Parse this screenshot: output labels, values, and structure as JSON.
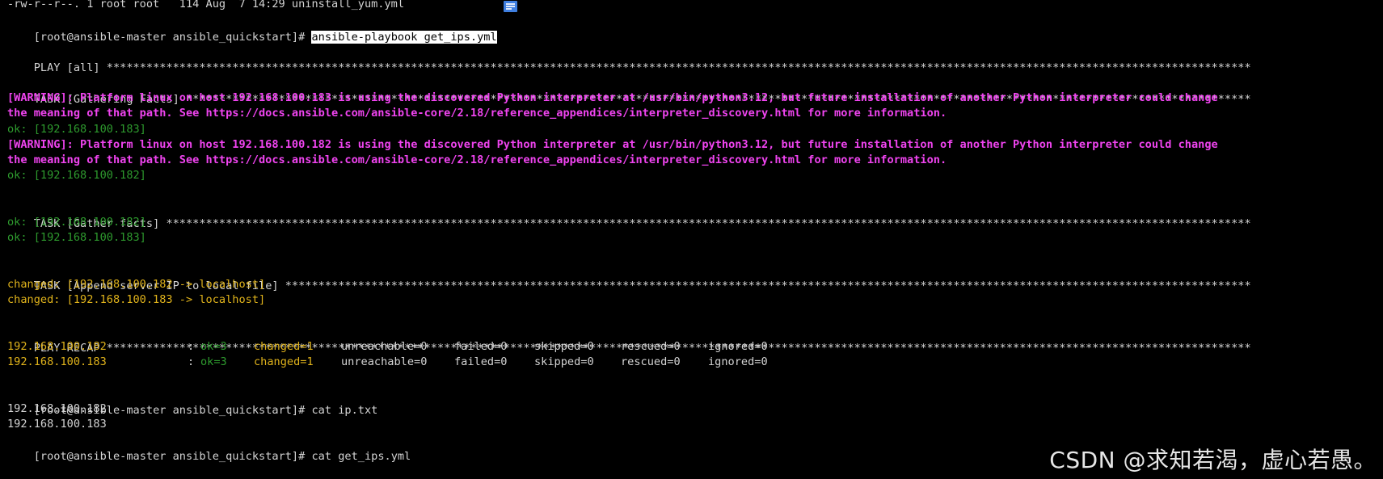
{
  "window": {
    "type": "terminal"
  },
  "colors": {
    "background": "#000000",
    "text": "#d4d4d4",
    "ok": "#2e9b2e",
    "changed": "#e0b31b",
    "warning": "#f044f0"
  },
  "icons": {
    "top_right_of_first_line": "note-icon"
  },
  "lines": {
    "ls_tail": "-rw-r--r--. 1 root root   114 Aug  7 14:29 uninstall_yum.yml",
    "prompt1": "[root@ansible-master ansible_quickstart]# ",
    "cmd1": "ansible-playbook get_ips.yml",
    "play_header": "PLAY [all] ",
    "task1_header": "TASK [Gathering Facts] ",
    "warn1_l1": "[WARNING]: Platform linux on host 192.168.100.183 is using the discovered Python interpreter at /usr/bin/python3.12, but future installation of another Python interpreter could change",
    "warn1_l2": "the meaning of that path. See https://docs.ansible.com/ansible-core/2.18/reference_appendices/interpreter_discovery.html for more information.",
    "ok1": "ok: [192.168.100.183]",
    "warn2_l1": "[WARNING]: Platform linux on host 192.168.100.182 is using the discovered Python interpreter at /usr/bin/python3.12, but future installation of another Python interpreter could change",
    "warn2_l2": "the meaning of that path. See https://docs.ansible.com/ansible-core/2.18/reference_appendices/interpreter_discovery.html for more information.",
    "ok2": "ok: [192.168.100.182]",
    "task2_header": "TASK [Gather facts] ",
    "ok3": "ok: [192.168.100.182]",
    "ok4": "ok: [192.168.100.183]",
    "task3_header": "TASK [Append server IP to local file] ",
    "changed1": "changed: [192.168.100.182 -> localhost]",
    "changed2": "changed: [192.168.100.183 -> localhost]",
    "recap_header": "PLAY RECAP ",
    "prompt2": "[root@ansible-master ansible_quickstart]# ",
    "cmd2": "cat ip.txt",
    "out1": "192.168.100.182",
    "out2": "192.168.100.183",
    "prompt3": "[root@ansible-master ansible_quickstart]# ",
    "cmd3": "cat get_ips.yml"
  },
  "recap": [
    {
      "host": "192.168.100.182",
      "sep": ": ",
      "ok": "ok=3",
      "changed": "changed=1",
      "unreachable": "unreachable=0",
      "failed": "failed=0",
      "skipped": "skipped=0",
      "rescued": "rescued=0",
      "ignored": "ignored=0"
    },
    {
      "host": "192.168.100.183",
      "sep": ": ",
      "ok": "ok=3",
      "changed": "changed=1",
      "unreachable": "unreachable=0",
      "failed": "failed=0",
      "skipped": "skipped=0",
      "rescued": "rescued=0",
      "ignored": "ignored=0"
    }
  ],
  "watermark": "CSDN @求知若渴，虚心若愚。"
}
